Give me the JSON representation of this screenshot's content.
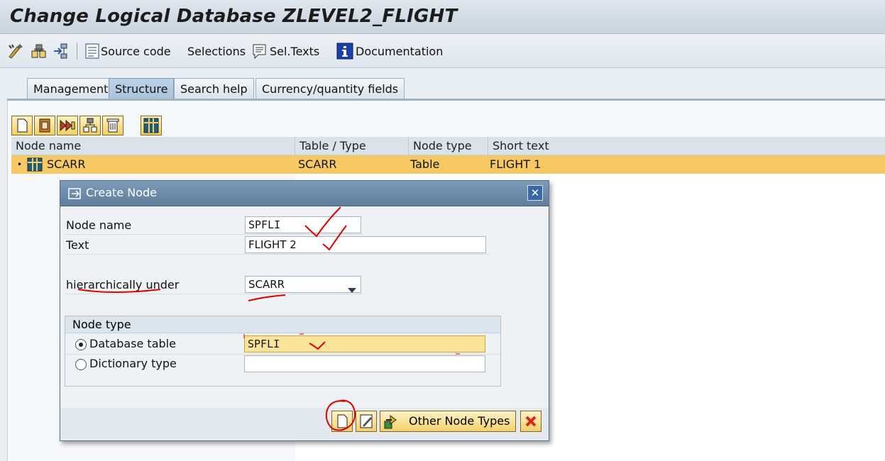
{
  "window": {
    "title": "Change Logical Database ZLEVEL2_FLIGHT"
  },
  "toolbar": {
    "source_code": "Source code",
    "selections": "Selections",
    "sel_texts": "Sel.Texts",
    "documentation": "Documentation"
  },
  "tabs": [
    {
      "label": "Management"
    },
    {
      "label": "Structure",
      "active": true
    },
    {
      "label": "Search help"
    },
    {
      "label": "Currency/quantity fields"
    }
  ],
  "table": {
    "columns": [
      "Node name",
      "Table / Type",
      "Node type",
      "Short text"
    ],
    "rows": [
      {
        "node_name": "SCARR",
        "table_type": "SCARR",
        "node_type": "Table",
        "short_text": "FLIGHT 1"
      }
    ]
  },
  "dialog": {
    "title": "Create Node",
    "close_glyph": "✕",
    "node_name_label": "Node name",
    "node_name_value": "SPFLI",
    "text_label": "Text",
    "text_value": "FLIGHT 2",
    "under_label": "hierarchically under",
    "under_value": "SCARR",
    "group_title": "Node type",
    "radio_db_label": "Database table",
    "radio_db_value": "SPFLI",
    "radio_dict_label": "Dictionary type",
    "radio_dict_value": "",
    "other_types_label": "Other Node Types"
  },
  "colors": {
    "selected_row": "#f7c964",
    "annotation": "#e00000",
    "title_bar": "#5f7e9d"
  }
}
